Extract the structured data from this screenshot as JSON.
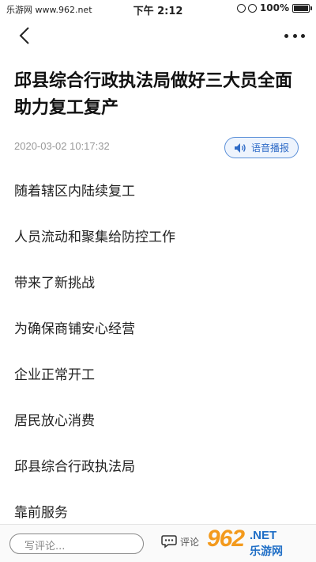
{
  "status_bar": {
    "site": "乐游网 www.962.net",
    "time": "下午 2:12",
    "battery": "100%",
    "battery_level": 1.0
  },
  "nav": {
    "back_icon": "chevron-left-icon",
    "more_icon": "more-dots-icon"
  },
  "article": {
    "title": "邱县综合行政执法局做好三大员全面助力复工复产",
    "date": "2020-03-02 10:17:32",
    "audio_label": "语音播报",
    "paragraphs": [
      "随着辖区内陆续复工",
      "人员流动和聚集给防控工作",
      "带来了新挑战",
      "为确保商铺安心经营",
      "企业正常开工",
      "居民放心消费",
      "邱县综合行政执法局",
      "靠前服务"
    ]
  },
  "bottom_bar": {
    "comment_placeholder": "写评论...",
    "comment_label": "评论"
  },
  "watermark": {
    "brand": "962",
    "suffix": ".NET",
    "cn": "乐游网"
  },
  "colors": {
    "accent": "#2f6bc7",
    "watermark_orange": "#f39a1d",
    "watermark_blue": "#1f6ec6"
  }
}
